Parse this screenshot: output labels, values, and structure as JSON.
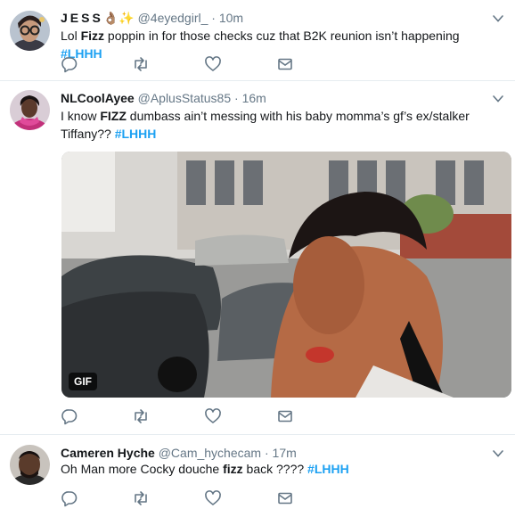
{
  "tweets": [
    {
      "name": "JESS",
      "name_emoji": "👌🏽✨",
      "handle": "@4eyedgirl_",
      "separator": "·",
      "time": "10m",
      "text_parts": [
        {
          "t": "Lol ",
          "style": "plain"
        },
        {
          "t": "Fizz",
          "style": "bold"
        },
        {
          "t": " poppin in for those checks cuz that B2K reunion isn’t happening ",
          "style": "plain"
        },
        {
          "t": "#LHHH",
          "style": "hashtag"
        }
      ]
    },
    {
      "name": "NLCoolAyee",
      "handle": "@AplusStatus85",
      "separator": "·",
      "time": "16m",
      "text_parts": [
        {
          "t": "I know ",
          "style": "plain"
        },
        {
          "t": "FIZZ",
          "style": "bold"
        },
        {
          "t": " dumbass ain’t messing with his baby momma’s gf’s ex/stalker",
          "style": "plain"
        },
        {
          "t": "Tiffany?? ",
          "style": "plain"
        },
        {
          "t": "#LHHH",
          "style": "hashtag"
        }
      ],
      "media_badge": "GIF"
    },
    {
      "name": "Cameren Hyche",
      "handle": "@Cam_hychecam",
      "separator": "·",
      "time": "17m",
      "text_parts": [
        {
          "t": "Oh Man more Cocky douche ",
          "style": "plain"
        },
        {
          "t": "fizz",
          "style": "bold"
        },
        {
          "t": " back ???? ",
          "style": "plain"
        },
        {
          "t": "#LHHH",
          "style": "hashtag"
        }
      ]
    }
  ],
  "icons": {
    "reply": "reply-icon",
    "retweet": "retweet-icon",
    "like": "heart-icon",
    "dm": "envelope-icon",
    "more": "chevron-down-icon"
  },
  "colors": {
    "hashtag": "#1da1f2",
    "secondary_text": "#657786",
    "icon": "#657786",
    "divider": "#e6ecf0"
  }
}
